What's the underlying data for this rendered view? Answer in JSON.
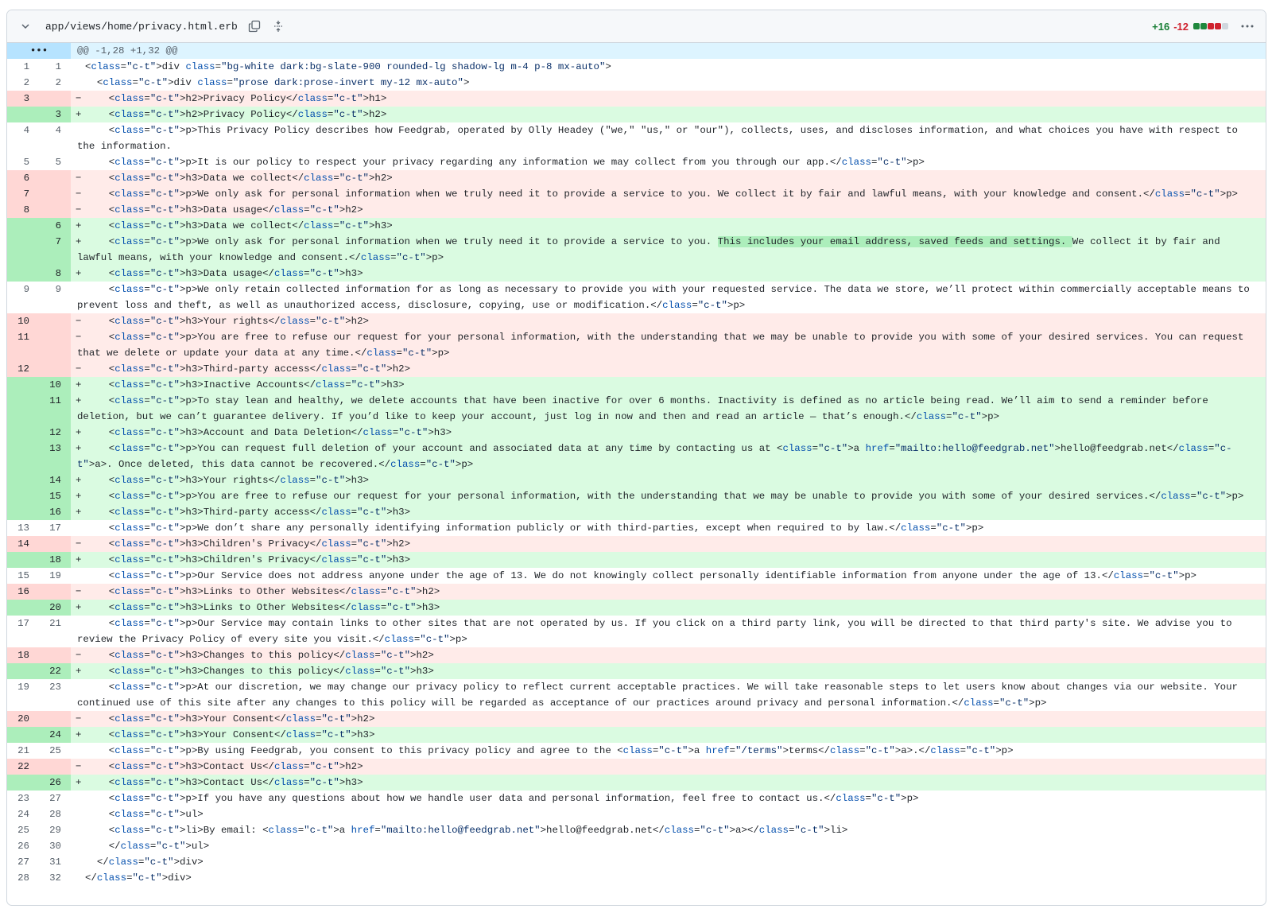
{
  "file": {
    "path": "app/views/home/privacy.html.erb",
    "additions": "+16",
    "deletions": "-12",
    "icons": {
      "collapse": "chevron-down-icon",
      "copy": "copy-icon",
      "expand_all": "unfold-icon",
      "more": "kebab-horizontal-icon"
    },
    "colors": {
      "add": "#1a7f37",
      "del": "#cf222e",
      "add_bg": "#dafbe1",
      "del_bg": "#ffebe9",
      "hunk_bg": "#ddf4ff"
    }
  },
  "hunk": {
    "expand": "•••",
    "header": "@@ -1,28 +1,32 @@"
  },
  "lines": [
    {
      "type": "ctx",
      "old": "1",
      "new": "1",
      "code": "<div class=\"bg-white dark:bg-slate-900 rounded-lg shadow-lg m-4 p-8 mx-auto\">"
    },
    {
      "type": "ctx",
      "old": "2",
      "new": "2",
      "code": "  <div class=\"prose dark:prose-invert my-12 mx-auto\">"
    },
    {
      "type": "del",
      "old": "3",
      "new": "",
      "code": "    <h2>Privacy Policy</h1>"
    },
    {
      "type": "add",
      "old": "",
      "new": "3",
      "code": "    <h2>Privacy Policy</h2>"
    },
    {
      "type": "ctx",
      "old": "4",
      "new": "4",
      "code": "    <p>This Privacy Policy describes how Feedgrab, operated by Olly Headey (\"we,\" \"us,\" or \"our\"), collects, uses, and discloses information, and what choices you have with respect to the information."
    },
    {
      "type": "ctx",
      "old": "5",
      "new": "5",
      "code": "    <p>It is our policy to respect your privacy regarding any information we may collect from you through our app.</p>"
    },
    {
      "type": "del",
      "old": "6",
      "new": "",
      "code": "    <h3>Data we collect</h2>"
    },
    {
      "type": "del",
      "old": "7",
      "new": "",
      "code": "    <p>We only ask for personal information when we truly need it to provide a service to you. We collect it by fair and lawful means, with your knowledge and consent.</p>"
    },
    {
      "type": "del",
      "old": "8",
      "new": "",
      "code": "    <h3>Data usage</h2>"
    },
    {
      "type": "add",
      "old": "",
      "new": "6",
      "code": "    <h3>Data we collect</h3>"
    },
    {
      "type": "add",
      "old": "",
      "new": "7",
      "code": "    <p>We only ask for personal information when we truly need it to provide a service to you. This includes your email address, saved feeds and settings. We collect it by fair and lawful means, with your knowledge and consent.</p>"
    },
    {
      "type": "add",
      "old": "",
      "new": "8",
      "code": "    <h3>Data usage</h3>"
    },
    {
      "type": "ctx",
      "old": "9",
      "new": "9",
      "code": "    <p>We only retain collected information for as long as necessary to provide you with your requested service. The data we store, we’ll protect within commercially acceptable means to prevent loss and theft, as well as unauthorized access, disclosure, copying, use or modification.</p>"
    },
    {
      "type": "del",
      "old": "10",
      "new": "",
      "code": "    <h3>Your rights</h2>"
    },
    {
      "type": "del",
      "old": "11",
      "new": "",
      "code": "    <p>You are free to refuse our request for your personal information, with the understanding that we may be unable to provide you with some of your desired services. You can request that we delete or update your data at any time.</p>"
    },
    {
      "type": "del",
      "old": "12",
      "new": "",
      "code": "    <h3>Third-party access</h2>"
    },
    {
      "type": "add",
      "old": "",
      "new": "10",
      "code": "    <h3>Inactive Accounts</h3>"
    },
    {
      "type": "add",
      "old": "",
      "new": "11",
      "code": "    <p>To stay lean and healthy, we delete accounts that have been inactive for over 6 months. Inactivity is defined as no article being read. We’ll aim to send a reminder before deletion, but we can’t guarantee delivery. If you’d like to keep your account, just log in now and then and read an article — that’s enough.</p>"
    },
    {
      "type": "add",
      "old": "",
      "new": "12",
      "code": "    <h3>Account and Data Deletion</h3>"
    },
    {
      "type": "add",
      "old": "",
      "new": "13",
      "code": "    <p>You can request full deletion of your account and associated data at any time by contacting us at <a href=\"mailto:hello@feedgrab.net\">hello@feedgrab.net</a>. Once deleted, this data cannot be recovered.</p>"
    },
    {
      "type": "add",
      "old": "",
      "new": "14",
      "code": "    <h3>Your rights</h3>"
    },
    {
      "type": "add",
      "old": "",
      "new": "15",
      "code": "    <p>You are free to refuse our request for your personal information, with the understanding that we may be unable to provide you with some of your desired services.</p>"
    },
    {
      "type": "add",
      "old": "",
      "new": "16",
      "code": "    <h3>Third-party access</h3>"
    },
    {
      "type": "ctx",
      "old": "13",
      "new": "17",
      "code": "    <p>We don’t share any personally identifying information publicly or with third-parties, except when required to by law.</p>"
    },
    {
      "type": "del",
      "old": "14",
      "new": "",
      "code": "    <h3>Children's Privacy</h2>"
    },
    {
      "type": "add",
      "old": "",
      "new": "18",
      "code": "    <h3>Children's Privacy</h3>"
    },
    {
      "type": "ctx",
      "old": "15",
      "new": "19",
      "code": "    <p>Our Service does not address anyone under the age of 13. We do not knowingly collect personally identifiable information from anyone under the age of 13.</p>"
    },
    {
      "type": "del",
      "old": "16",
      "new": "",
      "code": "    <h3>Links to Other Websites</h2>"
    },
    {
      "type": "add",
      "old": "",
      "new": "20",
      "code": "    <h3>Links to Other Websites</h3>"
    },
    {
      "type": "ctx",
      "old": "17",
      "new": "21",
      "code": "    <p>Our Service may contain links to other sites that are not operated by us. If you click on a third party link, you will be directed to that third party's site. We advise you to review the Privacy Policy of every site you visit.</p>"
    },
    {
      "type": "del",
      "old": "18",
      "new": "",
      "code": "    <h3>Changes to this policy</h2>"
    },
    {
      "type": "add",
      "old": "",
      "new": "22",
      "code": "    <h3>Changes to this policy</h3>"
    },
    {
      "type": "ctx",
      "old": "19",
      "new": "23",
      "code": "    <p>At our discretion, we may change our privacy policy to reflect current acceptable practices. We will take reasonable steps to let users know about changes via our website. Your continued use of this site after any changes to this policy will be regarded as acceptance of our practices around privacy and personal information.</p>"
    },
    {
      "type": "del",
      "old": "20",
      "new": "",
      "code": "    <h3>Your Consent</h2>"
    },
    {
      "type": "add",
      "old": "",
      "new": "24",
      "code": "    <h3>Your Consent</h3>"
    },
    {
      "type": "ctx",
      "old": "21",
      "new": "25",
      "code": "    <p>By using Feedgrab, you consent to this privacy policy and agree to the <a href=\"/terms\">terms</a>.</p>"
    },
    {
      "type": "del",
      "old": "22",
      "new": "",
      "code": "    <h3>Contact Us</h2>"
    },
    {
      "type": "add",
      "old": "",
      "new": "26",
      "code": "    <h3>Contact Us</h3>"
    },
    {
      "type": "ctx",
      "old": "23",
      "new": "27",
      "code": "    <p>If you have any questions about how we handle user data and personal information, feel free to contact us.</p>"
    },
    {
      "type": "ctx",
      "old": "24",
      "new": "28",
      "code": "    <ul>"
    },
    {
      "type": "ctx",
      "old": "25",
      "new": "29",
      "code": "    <li>By email: <a href=\"mailto:hello@feedgrab.net\">hello@feedgrab.net</a></li>"
    },
    {
      "type": "ctx",
      "old": "26",
      "new": "30",
      "code": "    </ul>"
    },
    {
      "type": "ctx",
      "old": "27",
      "new": "31",
      "code": "  </div>"
    },
    {
      "type": "ctx",
      "old": "28",
      "new": "32",
      "code": "</div>"
    }
  ]
}
